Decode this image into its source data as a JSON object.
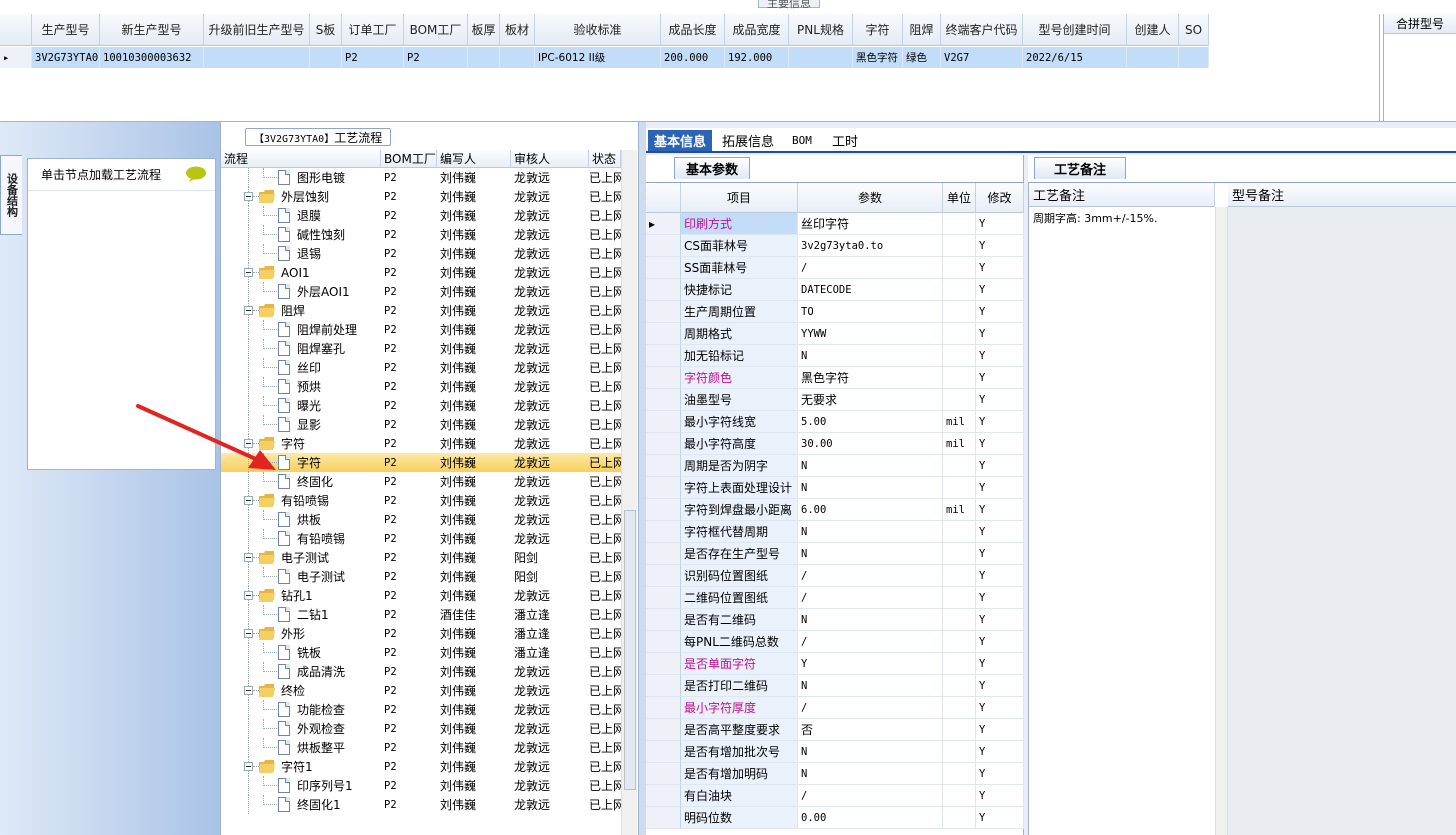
{
  "main_info": {
    "caption": "主要信息",
    "columns": [
      "生产型号",
      "新生产型号",
      "升级前旧生产型号",
      "S板",
      "订单工厂",
      "BOM工厂",
      "板厚",
      "板材",
      "验收标准",
      "成品长度",
      "成品宽度",
      "PNL规格",
      "字符",
      "阻焊",
      "终端客户代码",
      "型号创建时间",
      "创建人",
      "SO"
    ],
    "row": [
      "3V2G73YTA0",
      "10010300003632",
      "",
      "",
      "P2",
      "P2",
      "",
      "",
      "IPC-6012 II级",
      "200.000",
      "192.000",
      "",
      "黑色字符",
      "绿色",
      "V2G7",
      "2022/6/15",
      "",
      ""
    ],
    "right_panel_title": "合拼型号"
  },
  "left_side": {
    "vertical_tab": "设备结构",
    "load_hint": "单击节点加载工艺流程"
  },
  "tree": {
    "caption_code": "【3V2G73YTA0】",
    "caption_text": "工艺流程",
    "columns": [
      "流程",
      "BOM工厂",
      "编写人",
      "审核人",
      "状态"
    ],
    "rows": [
      {
        "level": 1,
        "name": "图形电镀",
        "bom": "P2",
        "writer": "刘伟巍",
        "reviewer": "龙敦远",
        "status": "已上网"
      },
      {
        "level": 0,
        "name": "外层蚀刻",
        "bom": "P2",
        "writer": "刘伟巍",
        "reviewer": "龙敦远",
        "status": "已上网"
      },
      {
        "level": 1,
        "name": "退膜",
        "bom": "P2",
        "writer": "刘伟巍",
        "reviewer": "龙敦远",
        "status": "已上网"
      },
      {
        "level": 1,
        "name": "碱性蚀刻",
        "bom": "P2",
        "writer": "刘伟巍",
        "reviewer": "龙敦远",
        "status": "已上网"
      },
      {
        "level": 1,
        "name": "退锡",
        "bom": "P2",
        "writer": "刘伟巍",
        "reviewer": "龙敦远",
        "status": "已上网"
      },
      {
        "level": 0,
        "name": "AOI1",
        "bom": "P2",
        "writer": "刘伟巍",
        "reviewer": "龙敦远",
        "status": "已上网"
      },
      {
        "level": 1,
        "name": "外层AOI1",
        "bom": "P2",
        "writer": "刘伟巍",
        "reviewer": "龙敦远",
        "status": "已上网"
      },
      {
        "level": 0,
        "name": "阻焊",
        "bom": "P2",
        "writer": "刘伟巍",
        "reviewer": "龙敦远",
        "status": "已上网"
      },
      {
        "level": 1,
        "name": "阻焊前处理",
        "bom": "P2",
        "writer": "刘伟巍",
        "reviewer": "龙敦远",
        "status": "已上网"
      },
      {
        "level": 1,
        "name": "阻焊塞孔",
        "bom": "P2",
        "writer": "刘伟巍",
        "reviewer": "龙敦远",
        "status": "已上网"
      },
      {
        "level": 1,
        "name": "丝印",
        "bom": "P2",
        "writer": "刘伟巍",
        "reviewer": "龙敦远",
        "status": "已上网"
      },
      {
        "level": 1,
        "name": "预烘",
        "bom": "P2",
        "writer": "刘伟巍",
        "reviewer": "龙敦远",
        "status": "已上网"
      },
      {
        "level": 1,
        "name": "曝光",
        "bom": "P2",
        "writer": "刘伟巍",
        "reviewer": "龙敦远",
        "status": "已上网"
      },
      {
        "level": 1,
        "name": "显影",
        "bom": "P2",
        "writer": "刘伟巍",
        "reviewer": "龙敦远",
        "status": "已上网"
      },
      {
        "level": 0,
        "name": "字符",
        "bom": "P2",
        "writer": "刘伟巍",
        "reviewer": "龙敦远",
        "status": "已上网"
      },
      {
        "level": 1,
        "name": "字符",
        "bom": "P2",
        "writer": "刘伟巍",
        "reviewer": "龙敦远",
        "status": "已上网",
        "selected": true
      },
      {
        "level": 1,
        "name": "终固化",
        "bom": "P2",
        "writer": "刘伟巍",
        "reviewer": "龙敦远",
        "status": "已上网"
      },
      {
        "level": 0,
        "name": "有铅喷锡",
        "bom": "P2",
        "writer": "刘伟巍",
        "reviewer": "龙敦远",
        "status": "已上网"
      },
      {
        "level": 1,
        "name": "烘板",
        "bom": "P2",
        "writer": "刘伟巍",
        "reviewer": "龙敦远",
        "status": "已上网"
      },
      {
        "level": 1,
        "name": "有铅喷锡",
        "bom": "P2",
        "writer": "刘伟巍",
        "reviewer": "龙敦远",
        "status": "已上网"
      },
      {
        "level": 0,
        "name": "电子测试",
        "bom": "P2",
        "writer": "刘伟巍",
        "reviewer": "阳剑",
        "status": "已上网"
      },
      {
        "level": 1,
        "name": "电子测试",
        "bom": "P2",
        "writer": "刘伟巍",
        "reviewer": "阳剑",
        "status": "已上网"
      },
      {
        "level": 0,
        "name": "钻孔1",
        "bom": "P2",
        "writer": "刘伟巍",
        "reviewer": "龙敦远",
        "status": "已上网"
      },
      {
        "level": 1,
        "name": "二钻1",
        "bom": "P2",
        "writer": "酒佳佳",
        "reviewer": "潘立逢",
        "status": "已上网"
      },
      {
        "level": 0,
        "name": "外形",
        "bom": "P2",
        "writer": "刘伟巍",
        "reviewer": "潘立逢",
        "status": "已上网"
      },
      {
        "level": 1,
        "name": "铣板",
        "bom": "P2",
        "writer": "刘伟巍",
        "reviewer": "潘立逢",
        "status": "已上网"
      },
      {
        "level": 1,
        "name": "成品清洗",
        "bom": "P2",
        "writer": "刘伟巍",
        "reviewer": "龙敦远",
        "status": "已上网"
      },
      {
        "level": 0,
        "name": "终检",
        "bom": "P2",
        "writer": "刘伟巍",
        "reviewer": "龙敦远",
        "status": "已上网"
      },
      {
        "level": 1,
        "name": "功能检查",
        "bom": "P2",
        "writer": "刘伟巍",
        "reviewer": "龙敦远",
        "status": "已上网"
      },
      {
        "level": 1,
        "name": "外观检查",
        "bom": "P2",
        "writer": "刘伟巍",
        "reviewer": "龙敦远",
        "status": "已上网"
      },
      {
        "level": 1,
        "name": "烘板整平",
        "bom": "P2",
        "writer": "刘伟巍",
        "reviewer": "龙敦远",
        "status": "已上网"
      },
      {
        "level": 0,
        "name": "字符1",
        "bom": "P2",
        "writer": "刘伟巍",
        "reviewer": "龙敦远",
        "status": "已上网"
      },
      {
        "level": 1,
        "name": "印序列号1",
        "bom": "P2",
        "writer": "刘伟巍",
        "reviewer": "龙敦远",
        "status": "已上网"
      },
      {
        "level": 1,
        "name": "终固化1",
        "bom": "P2",
        "writer": "刘伟巍",
        "reviewer": "龙敦远",
        "status": "已上网"
      }
    ]
  },
  "tabs": [
    {
      "label": "基本信息",
      "active": true
    },
    {
      "label": "拓展信息"
    },
    {
      "label": "BOM"
    },
    {
      "label": "工时"
    }
  ],
  "basic_params": {
    "panel_tab": "基本参数",
    "columns": [
      "项目",
      "参数",
      "单位",
      "修改"
    ],
    "rows": [
      {
        "name": "印刷方式",
        "value": "丝印字符",
        "unit": "",
        "mod": "Y",
        "highlight": true
      },
      {
        "name": "CS面菲林号",
        "value": "3v2g73yta0.to",
        "unit": "",
        "mod": "Y"
      },
      {
        "name": "SS面菲林号",
        "value": "/",
        "unit": "",
        "mod": "Y"
      },
      {
        "name": "快捷标记",
        "value": "DATECODE",
        "unit": "",
        "mod": "Y"
      },
      {
        "name": "生产周期位置",
        "value": "TO",
        "unit": "",
        "mod": "Y"
      },
      {
        "name": "周期格式",
        "value": "YYWW",
        "unit": "",
        "mod": "Y"
      },
      {
        "name": "加无铅标记",
        "value": "N",
        "unit": "",
        "mod": "Y"
      },
      {
        "name": "字符颜色",
        "value": "黑色字符",
        "unit": "",
        "mod": "Y",
        "highlight": true
      },
      {
        "name": "油墨型号",
        "value": "无要求",
        "unit": "",
        "mod": "Y"
      },
      {
        "name": "最小字符线宽",
        "value": "5.00",
        "unit": "mil",
        "mod": "Y"
      },
      {
        "name": "最小字符高度",
        "value": "30.00",
        "unit": "mil",
        "mod": "Y"
      },
      {
        "name": "周期是否为阴字",
        "value": "N",
        "unit": "",
        "mod": "Y"
      },
      {
        "name": "字符上表面处理设计",
        "value": "N",
        "unit": "",
        "mod": "Y"
      },
      {
        "name": "字符到焊盘最小距离",
        "value": "6.00",
        "unit": "mil",
        "mod": "Y"
      },
      {
        "name": "字符框代替周期",
        "value": "N",
        "unit": "",
        "mod": "Y"
      },
      {
        "name": "是否存在生产型号",
        "value": "N",
        "unit": "",
        "mod": "Y"
      },
      {
        "name": "识别码位置图纸",
        "value": "/",
        "unit": "",
        "mod": "Y"
      },
      {
        "name": "二维码位置图纸",
        "value": "/",
        "unit": "",
        "mod": "Y"
      },
      {
        "name": "是否有二维码",
        "value": "N",
        "unit": "",
        "mod": "Y"
      },
      {
        "name": "每PNL二维码总数",
        "value": "/",
        "unit": "",
        "mod": "Y"
      },
      {
        "name": "是否单面字符",
        "value": "Y",
        "unit": "",
        "mod": "Y",
        "highlight": true
      },
      {
        "name": "是否打印二维码",
        "value": "N",
        "unit": "",
        "mod": "Y"
      },
      {
        "name": "最小字符厚度",
        "value": "/",
        "unit": "",
        "mod": "Y",
        "highlight": true
      },
      {
        "name": "是否高平整度要求",
        "value": "否",
        "unit": "",
        "mod": "Y"
      },
      {
        "name": "是否有增加批次号",
        "value": "N",
        "unit": "",
        "mod": "Y"
      },
      {
        "name": "是否有增加明码",
        "value": "N",
        "unit": "",
        "mod": "Y"
      },
      {
        "name": "有白油块",
        "value": "/",
        "unit": "",
        "mod": "Y"
      },
      {
        "name": "明码位数",
        "value": "0.00",
        "unit": "",
        "mod": "Y"
      }
    ]
  },
  "remarks": {
    "panel_tab": "工艺备注",
    "col_process": "工艺备注",
    "col_model": "型号备注",
    "process_text": "周期字高: 3mm+/-15%."
  },
  "colors": {
    "accent": "#2c63b7",
    "selected_row": "#c3dcf7",
    "tree_selected": "#f7cf5c",
    "highlight_text": "#c0108a",
    "arrow": "#e52222"
  }
}
